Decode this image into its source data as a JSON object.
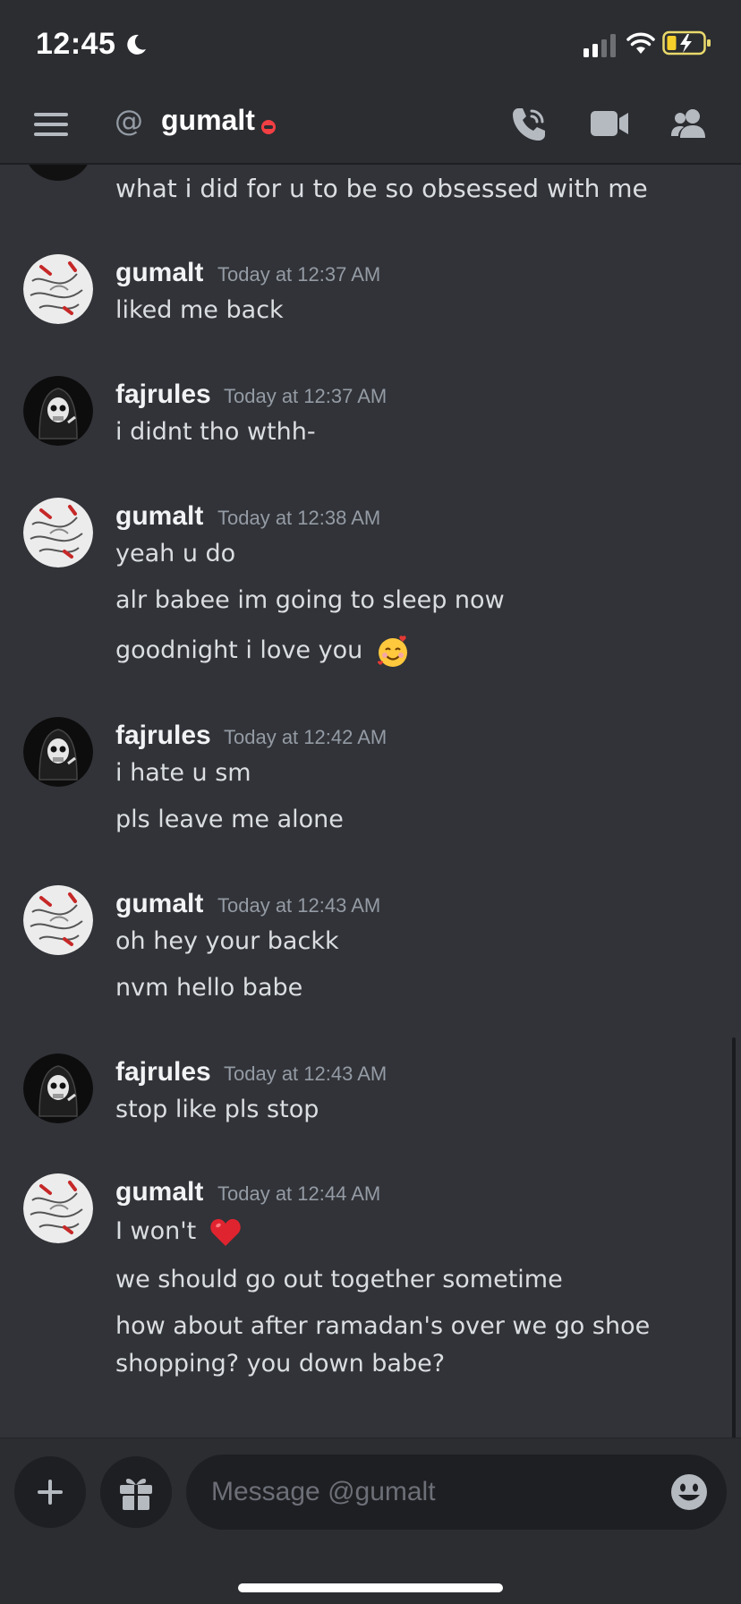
{
  "status_bar": {
    "time": "12:45",
    "icons": [
      "moon-icon",
      "signal-icon",
      "wifi-icon",
      "battery-icon"
    ]
  },
  "header": {
    "prefix_icon": "at-icon",
    "channel_name": "gumalt",
    "status": "do-not-disturb",
    "actions": [
      "call-icon",
      "video-icon",
      "members-icon"
    ]
  },
  "colors": {
    "background": "#313338",
    "header": "#2b2d31",
    "dnd_status": "#f23f43",
    "timestamp": "#949ba4"
  },
  "partial_message": "what i did for u to be so obsessed with me",
  "messages": [
    {
      "author": "gumalt",
      "timestamp": "Today at 12:37 AM",
      "lines": [
        "liked me back"
      ]
    },
    {
      "author": "fajrules",
      "timestamp": "Today at 12:37 AM",
      "lines": [
        "i didnt tho wthh-"
      ]
    },
    {
      "author": "gumalt",
      "timestamp": "Today at 12:38 AM",
      "lines": [
        "yeah u do",
        "alr babee im going to sleep now",
        "goodnight i love you"
      ],
      "emoji": "smiling-face-with-hearts"
    },
    {
      "author": "fajrules",
      "timestamp": "Today at 12:42 AM",
      "lines": [
        "i hate u sm",
        "pls leave me alone"
      ]
    },
    {
      "author": "gumalt",
      "timestamp": "Today at 12:43 AM",
      "lines": [
        "oh hey your backk",
        "nvm hello babe"
      ]
    },
    {
      "author": "fajrules",
      "timestamp": "Today at 12:43 AM",
      "lines": [
        "stop like pls stop"
      ]
    },
    {
      "author": "gumalt",
      "timestamp": "Today at 12:44 AM",
      "lines": [
        "I won't",
        "we should go out together sometime",
        "how about after ramadan's over we go shoe",
        "shopping? you down babe?"
      ],
      "emoji": "red-heart"
    }
  ],
  "composer": {
    "placeholder": "Message @gumalt",
    "buttons": [
      "plus-icon",
      "gift-icon",
      "emoji-icon"
    ]
  }
}
